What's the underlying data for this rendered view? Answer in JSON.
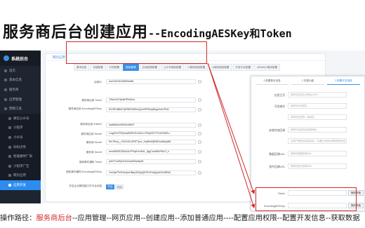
{
  "slide": {
    "title_cn": "服务商后台创建应用",
    "title_sep": "--",
    "title_en1": "EncodingAESKey",
    "title_and": "和",
    "title_en2": "Token"
  },
  "sidebar": {
    "title": "系统后台",
    "items": [
      {
        "label": "首页",
        "level": 0,
        "active": false
      },
      {
        "label": "基本信息",
        "level": 0,
        "active": false
      },
      {
        "label": "服务商",
        "level": 0,
        "active": false
      },
      {
        "label": "应用管理",
        "level": 0,
        "active": false
      },
      {
        "label": "营销工具",
        "level": 0,
        "active": false
      },
      {
        "label": "微信公众号",
        "level": 1,
        "active": false
      },
      {
        "label": "小程序",
        "level": 1,
        "active": false
      },
      {
        "label": "小众号",
        "level": 1,
        "active": false
      },
      {
        "label": "扫码点单",
        "level": 1,
        "active": false
      },
      {
        "label": "智能硬件厂商",
        "level": 1,
        "active": false
      },
      {
        "label": "小程序广告",
        "level": 1,
        "active": false
      },
      {
        "label": "网页应用",
        "level": 1,
        "active": false
      },
      {
        "label": "应用开发",
        "level": 1,
        "active": true
      }
    ]
  },
  "panel": {
    "header": "网页应用",
    "tabs": [
      {
        "label": "基本信息",
        "active": false
      },
      {
        "label": "功能配置",
        "active": false
      },
      {
        "label": "开发配置",
        "active": false
      },
      {
        "label": "授权管理",
        "active": true
      },
      {
        "label": "应用权限配置",
        "active": false
      },
      {
        "label": "公众号授权配置",
        "active": false
      },
      {
        "label": "小程序授权配置",
        "active": false
      },
      {
        "label": "小程序授权配置",
        "active": false
      },
      {
        "label": "开放平台配置",
        "active": false
      },
      {
        "label": "AWMA小程序配置",
        "active": false
      }
    ],
    "form": [
      {
        "label": "应用ID",
        "value": "wx210016135f054d66"
      },
      {
        "label": "服务商应用 Token",
        "value": "J3hzmCXfpnkHPfs4km"
      },
      {
        "label": "服务商应用 EncodingAESKey",
        "value": "fG2SEdBMCQfR6ESf0DwQpuV9PWnpBxgwhrhJP4A"
      },
      {
        "label": "服务商应用 SuiteID",
        "value": "ww8a6a1e5934e4f603"
      },
      {
        "label": "服务商应用 Secret",
        "value": "LzqpFeZT9Q4sa69ZKGhVoiN-u7N3p2ZVT7m0Z0M1u"
      },
      {
        "label": "服务商 Secret",
        "value": "Wv7Boq__rFbG4CLBFIFTpzr_JxqRsWjDMRouMkqJ86"
      },
      {
        "label": "服务商 Secret",
        "value": "wmh6EREZ6iSs3LPPNpFeriH4L_8jgCan5RxPBh7t_k"
      },
      {
        "label": "授权事件通知 Token",
        "value": "phkTGroRj2zDk14wdE6sdbpM"
      },
      {
        "label": "授权事件通知 EncodingAESKey",
        "value": "YwGjzFPePn6JpuHBay3DQqQ6T6XFn0gUp4HXdfRd0"
      },
      {
        "label": "开启企业微信接口开平台对接",
        "switch_on": "开启",
        "switch_off": "关闭"
      }
    ]
  },
  "detail": {
    "steps": [
      "1 配置基本信息",
      "2 完善功能",
      "3 配置开发信息"
    ],
    "rows": [
      {
        "label": "应用主页",
        "placeholder": "请填写应用主页地址(URL)"
      },
      {
        "label": "可信域名",
        "placeholder": "请填写可信域名"
      },
      {
        "label": "",
        "placeholder": "请填写应用的一级域名"
      },
      {
        "label": "安装完成回调",
        "placeholder": "请填写安装完成回调地址"
      },
      {
        "label": "",
        "placeholder": "当用户授权安装应用后，可通过该地址获取授权信息"
      },
      {
        "label": "数据回调URL",
        "placeholder": "请填写数据回调URL"
      },
      {
        "label": "指令回调URL",
        "placeholder": "请填写指令回调URL"
      },
      {
        "label": "Token",
        "placeholder": "",
        "button": "随机获取"
      },
      {
        "label": "EncodingAESKey",
        "placeholder": "",
        "button": "随机获取"
      }
    ]
  },
  "flow": {
    "prefix": "操作路径：",
    "highlight": "服务商后台",
    "rest": "--应用管理--网页应用--创建应用--添加普通应用----配置应用权限--配置开发信息--获取数据"
  },
  "colors": {
    "accent": "#3a8ee6",
    "highlight": "#d02a2a",
    "sidebar_bg": "#1e2530"
  }
}
